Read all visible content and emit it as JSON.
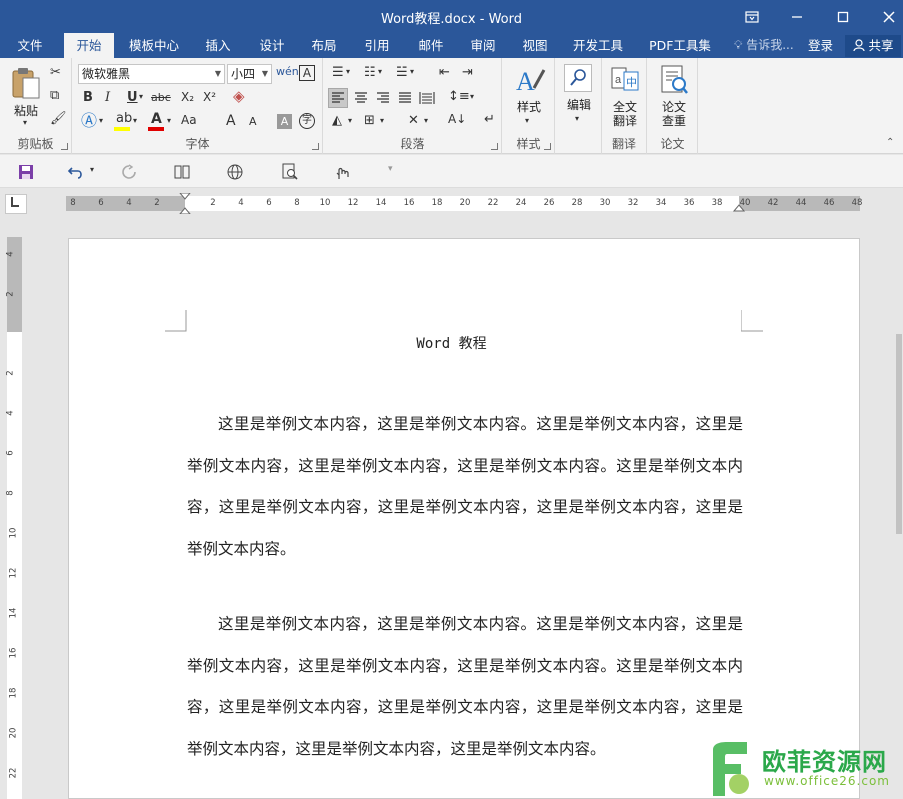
{
  "window": {
    "title": "Word教程.docx - Word",
    "controls": [
      "ribbon-options",
      "minimize",
      "maximize",
      "close"
    ]
  },
  "tabs": [
    {
      "label": "文件",
      "active": false
    },
    {
      "label": "开始",
      "active": true
    },
    {
      "label": "模板中心",
      "active": false
    },
    {
      "label": "插入",
      "active": false
    },
    {
      "label": "设计",
      "active": false
    },
    {
      "label": "布局",
      "active": false
    },
    {
      "label": "引用",
      "active": false
    },
    {
      "label": "邮件",
      "active": false
    },
    {
      "label": "审阅",
      "active": false
    },
    {
      "label": "视图",
      "active": false
    },
    {
      "label": "开发工具",
      "active": false
    },
    {
      "label": "PDF工具集",
      "active": false
    }
  ],
  "tellme": "告诉我...",
  "login": "登录",
  "share": "共享",
  "ribbon": {
    "clipboard": {
      "paste": "粘贴",
      "label": "剪贴板"
    },
    "font": {
      "font_name": "微软雅黑",
      "font_size": "小四",
      "label": "字体",
      "bold": "B",
      "italic": "I",
      "underline": "U",
      "strike": "abc",
      "subscript": "X₂",
      "superscript": "X²",
      "grow": "A",
      "shrink": "A",
      "change_case": "Aa",
      "highlight_color": "#ffff00",
      "font_color": "#e00000"
    },
    "paragraph": {
      "label": "段落"
    },
    "styles": {
      "button": "样式",
      "label": "样式"
    },
    "editing": {
      "button": "编辑"
    },
    "translate": {
      "button_line1": "全文",
      "button_line2": "翻译",
      "label": "翻译"
    },
    "paper": {
      "button_line1": "论文",
      "button_line2": "查重",
      "label": "论文"
    }
  },
  "ruler": {
    "h_ticks": [
      "8",
      "6",
      "4",
      "2",
      "2",
      "4",
      "6",
      "8",
      "10",
      "12",
      "14",
      "16",
      "18",
      "20",
      "22",
      "24",
      "26",
      "28",
      "30",
      "32",
      "34",
      "36",
      "38",
      "40",
      "42",
      "44",
      "46",
      "48"
    ],
    "v_ticks": [
      "4",
      "2",
      "2",
      "4",
      "6",
      "8",
      "10",
      "12",
      "14",
      "16",
      "18",
      "20",
      "22"
    ]
  },
  "document": {
    "title": "Word 教程",
    "paragraphs": [
      "这里是举例文本内容，这里是举例文本内容。这里是举例文本内容，这里是举例文本内容，这里是举例文本内容，这里是举例文本内容。这里是举例文本内容，这里是举例文本内容，这里是举例文本内容，这里是举例文本内容，这里是举例文本内容。",
      "这里是举例文本内容，这里是举例文本内容。这里是举例文本内容，这里是举例文本内容，这里是举例文本内容，这里是举例文本内容。这里是举例文本内容，这里是举例文本内容，这里是举例文本内容，这里是举例文本内容，这里是举例文本内容，这里是举例文本内容，这里是举例文本内容。"
    ]
  },
  "watermark": {
    "brand": "欧菲资源网",
    "url": "www.office26.com"
  },
  "colors": {
    "accent": "#2b579a",
    "ribbon_bg": "#f3f3f3",
    "canvas_bg": "#e6e6e6",
    "watermark_green": "#2ba84a"
  }
}
